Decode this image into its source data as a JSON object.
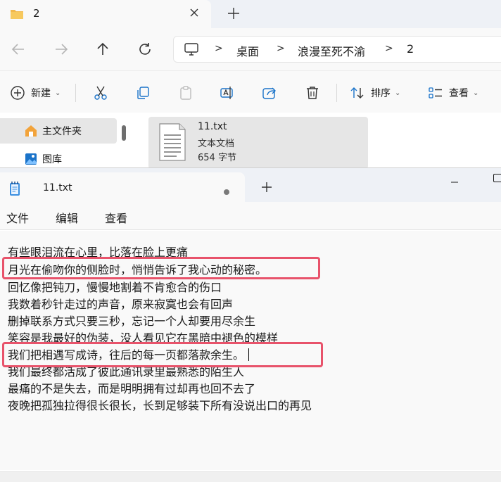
{
  "explorer": {
    "tab": {
      "title": "2"
    },
    "address": {
      "crumbs": [
        "桌面",
        "浪漫至死不渝",
        "2"
      ]
    },
    "toolbar": {
      "new_label": "新建",
      "sort_label": "排序",
      "view_label": "查看"
    },
    "sidebar": {
      "items": [
        {
          "label": "主文件夹",
          "icon": "home-icon"
        },
        {
          "label": "图库",
          "icon": "gallery-icon"
        }
      ]
    },
    "file": {
      "name": "11.txt",
      "type": "文本文档",
      "size": "654 字节"
    }
  },
  "notepad": {
    "tab": {
      "title": "11.txt"
    },
    "menu": {
      "file": "文件",
      "edit": "编辑",
      "view": "查看"
    },
    "lines": [
      "有些眼泪流在心里，比落在脸上更痛",
      "月光在偷吻你的侧脸时，悄悄告诉了我心动的秘密。",
      "回忆像把钝刀，慢慢地割着不肯愈合的伤口",
      "我数着秒针走过的声音，原来寂寞也会有回声",
      "删掉联系方式只要三秒，忘记一个人却要用尽余生",
      "笑容是我最好的伪装，没人看见它在黑暗中褪色的模样",
      "我们把相遇写成诗，往后的每一页都落款余生。",
      "我们最终都活成了彼此通讯录里最熟悉的陌生人",
      "最痛的不是失去，而是明明拥有过却再也回不去了",
      "夜晚把孤独拉得很长很长，长到足够装下所有没说出口的再见"
    ]
  },
  "colors": {
    "highlight": "#e8536b",
    "folder": "#f2b84b",
    "accent_blue": "#1a73c9"
  }
}
